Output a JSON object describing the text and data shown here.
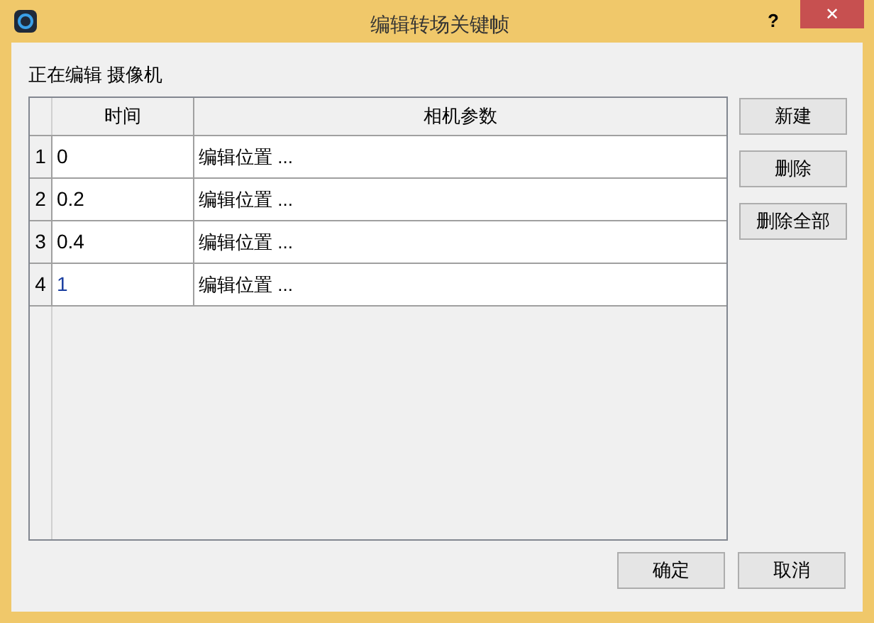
{
  "window": {
    "title": "编辑转场关键帧",
    "help": "?",
    "close": "✕"
  },
  "editing_label": "正在编辑 摄像机",
  "table": {
    "columns": [
      "时间",
      "相机参数"
    ],
    "rows": [
      {
        "number": "1",
        "time": "0",
        "params": "编辑位置 ...",
        "selected": false
      },
      {
        "number": "2",
        "time": "0.2",
        "params": "编辑位置 ...",
        "selected": false
      },
      {
        "number": "3",
        "time": "0.4",
        "params": "编辑位置 ...",
        "selected": false
      },
      {
        "number": "4",
        "time": "1",
        "params": "编辑位置 ...",
        "selected": true
      }
    ]
  },
  "side_buttons": [
    "新建",
    "删除",
    "删除全部"
  ],
  "footer_buttons": [
    "确定",
    "取消"
  ]
}
